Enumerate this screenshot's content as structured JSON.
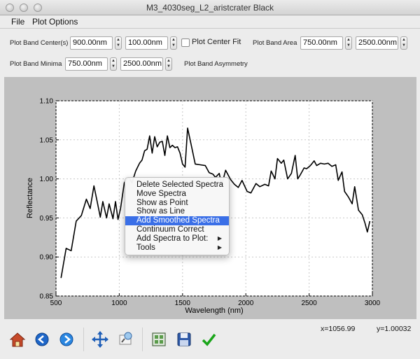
{
  "window": {
    "title": "M3_4030seg_L2_aristcrater Black"
  },
  "menubar": {
    "file": "File",
    "plot_options": "Plot Options"
  },
  "controls": {
    "band_center": {
      "label": "Plot Band Center(s)",
      "min": "900.00nm",
      "max": "100.00nm"
    },
    "center_fit": {
      "label": "Plot Center Fit",
      "checked": false
    },
    "band_area": {
      "label": "Plot Band Area",
      "min": "750.00nm",
      "max": "2500.00nm"
    },
    "band_minima": {
      "label": "Plot Band Minima",
      "min": "750.00nm",
      "max": "2500.00nm"
    },
    "band_asymmetry": {
      "label": "Plot Band Asymmetry"
    }
  },
  "context_menu": {
    "items": [
      {
        "label": "Delete Selected Spectra"
      },
      {
        "label": "Move Spectra"
      },
      {
        "label": "Show as Point"
      },
      {
        "label": "Show as Line"
      },
      {
        "label": "Add Smoothed Spectra",
        "active": true
      },
      {
        "label": "Continuum Correct"
      },
      {
        "label": "Add Spectra to Plot:",
        "submenu": true
      },
      {
        "label": "Tools",
        "submenu": true
      }
    ]
  },
  "status": {
    "x": "x=1056.99",
    "y": "y=1.00032"
  },
  "icons": {
    "home": "home-icon",
    "back": "back-arrow-icon",
    "forward": "forward-arrow-icon",
    "pan": "pan-icon",
    "zoom": "zoom-icon",
    "subplots": "subplots-icon",
    "save": "save-icon",
    "check": "check-icon"
  },
  "colors": {
    "highlight": "#3a6fe7",
    "plot_bg": "#bfbfbf",
    "line": "#000000",
    "back_arrow": "#1e66c8"
  },
  "chart_data": {
    "type": "line",
    "xlabel": "Wavelength (nm)",
    "ylabel": "Reflectance",
    "xlim": [
      500,
      3000
    ],
    "ylim": [
      0.85,
      1.1
    ],
    "xticks": [
      500,
      1000,
      1500,
      2000,
      2500,
      3000
    ],
    "yticks": [
      0.85,
      0.9,
      0.95,
      1.0,
      1.05,
      1.1
    ],
    "ytick_labels": [
      "0.85",
      "0.90",
      "0.95",
      "1.00",
      "1.05",
      "1.10"
    ],
    "grid": true,
    "series": [
      {
        "x": [
          540,
          580,
          620,
          660,
          700,
          740,
          770,
          800,
          820,
          850,
          870,
          900,
          920,
          950,
          970,
          990,
          1010,
          1040,
          1060,
          1080,
          1100,
          1130,
          1160,
          1180,
          1200,
          1220,
          1240,
          1260,
          1280,
          1300,
          1320,
          1340,
          1360,
          1380,
          1400,
          1420,
          1440,
          1460,
          1480,
          1500,
          1520,
          1540,
          1570,
          1600,
          1640,
          1680,
          1710,
          1740,
          1760,
          1790,
          1810,
          1840,
          1880,
          1910,
          1940,
          1970,
          2010,
          2040,
          2080,
          2110,
          2150,
          2180,
          2200,
          2230,
          2250,
          2280,
          2300,
          2330,
          2360,
          2390,
          2410,
          2430,
          2460,
          2480,
          2510,
          2540,
          2560,
          2590,
          2620,
          2650,
          2680,
          2710,
          2730,
          2760,
          2780,
          2810,
          2840,
          2860,
          2890,
          2920,
          2940,
          2960,
          2980
        ],
        "y": [
          0.873,
          0.911,
          0.908,
          0.946,
          0.953,
          0.974,
          0.962,
          0.991,
          0.975,
          0.951,
          0.971,
          0.95,
          0.968,
          0.949,
          0.971,
          0.948,
          0.962,
          0.995,
          1.0,
          1.001,
          0.995,
          1.01,
          1.02,
          1.024,
          1.036,
          1.038,
          1.055,
          1.033,
          1.054,
          1.041,
          1.047,
          1.048,
          1.03,
          1.055,
          1.04,
          1.043,
          1.04,
          1.041,
          1.033,
          1.019,
          1.015,
          1.065,
          1.042,
          1.019,
          1.018,
          1.017,
          1.008,
          1.006,
          1.002,
          1.007,
          0.992,
          1.011,
          0.999,
          0.993,
          0.989,
          0.998,
          0.984,
          0.982,
          0.994,
          0.99,
          0.993,
          0.991,
          1.01,
          1.0,
          1.026,
          1.02,
          1.024,
          1.0,
          1.007,
          1.03,
          1.0,
          1.005,
          1.014,
          1.013,
          1.017,
          1.023,
          1.017,
          1.02,
          1.019,
          1.02,
          1.016,
          1.018,
          0.998,
          1.009,
          0.984,
          0.977,
          0.968,
          0.99,
          0.96,
          0.954,
          0.944,
          0.932,
          0.946
        ]
      }
    ]
  }
}
